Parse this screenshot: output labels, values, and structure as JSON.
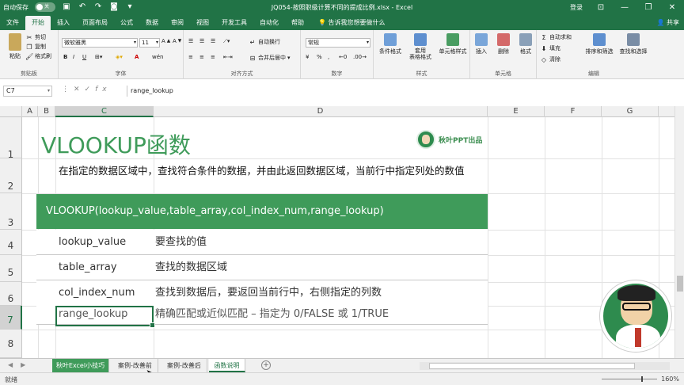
{
  "window": {
    "autosave_label": "自动保存",
    "autosave_state": "关",
    "title": "JQ054-按照职级计算不同的提成比例.xlsx  -  Excel",
    "login": "登录",
    "minimize": "—",
    "restore": "❐",
    "close": "✕"
  },
  "ribbon_tabs": [
    "文件",
    "开始",
    "插入",
    "页面布局",
    "公式",
    "数据",
    "审阅",
    "视图",
    "开发工具",
    "自动化",
    "帮助"
  ],
  "tell_me": "告诉我您想要做什么",
  "share": "共享",
  "ribbon": {
    "clipboard": {
      "paste": "粘贴",
      "cut": "剪切",
      "copy": "复制",
      "format_painter": "格式刷",
      "label": "剪贴板"
    },
    "font": {
      "name": "微软雅黑",
      "size": "11",
      "label": "字体",
      "bold": "B",
      "italic": "I",
      "underline": "U",
      "font_color": "A",
      "wen": "wén"
    },
    "alignment": {
      "wrap": "自动换行",
      "merge": "合并后居中",
      "label": "对齐方式"
    },
    "number": {
      "format": "常规",
      "label": "数字",
      "percent": "%",
      "comma": ",",
      "currency": "¥"
    },
    "styles": {
      "conditional": "条件格式",
      "table": "套用\n表格格式",
      "cell_styles": "单元格样式",
      "label": "样式"
    },
    "cells": {
      "insert": "插入",
      "delete": "删除",
      "format": "格式",
      "label": "单元格"
    },
    "editing": {
      "autosum": "自动求和",
      "fill": "填充",
      "clear": "清除",
      "sort": "排序和筛选",
      "find": "查找和选择",
      "label": "编辑"
    }
  },
  "formula_bar": {
    "name_box": "C7",
    "formula": "range_lookup"
  },
  "columns": [
    "A",
    "B",
    "C",
    "D",
    "E",
    "F",
    "G"
  ],
  "rows": [
    "1",
    "2",
    "3",
    "4",
    "5",
    "6",
    "7",
    "8"
  ],
  "sheet": {
    "title": "VLOOKUP函数",
    "logo_text": "秋叶PPT出品",
    "description": "在指定的数据区域中，查找符合条件的数据，并由此返回数据区域，当前行中指定列处的数值",
    "syntax": "VLOOKUP(lookup_value,table_array,col_index_num,range_lookup)",
    "params": [
      {
        "name": "lookup_value",
        "desc": "要查找的值"
      },
      {
        "name": "table_array",
        "desc": "查找的数据区域"
      },
      {
        "name": "col_index_num",
        "desc": "查找到数据后，要返回当前行中，右侧指定的列数"
      },
      {
        "name": "range_lookup",
        "desc": "精确匹配或近似匹配 – 指定为 0/FALSE 或 1/TRUE"
      }
    ]
  },
  "sheet_tabs": [
    {
      "label": "秋叶Excel小技巧"
    },
    {
      "label": "案例-改善前"
    },
    {
      "label": "案例-改善后"
    },
    {
      "label": "函数说明"
    }
  ],
  "status": {
    "ready": "就绪",
    "zoom": "160%"
  },
  "colors": {
    "excel_green": "#217346",
    "accent_green": "#3f9b5a"
  }
}
